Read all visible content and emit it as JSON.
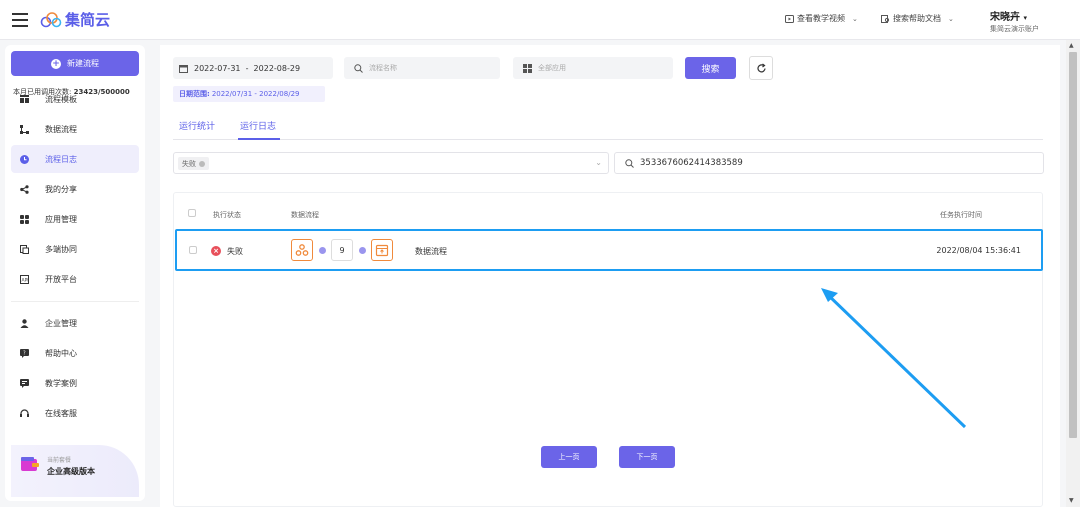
{
  "header": {
    "logo_text": "集简云",
    "link_video": "查看教学视频",
    "link_docs": "搜索帮助文档",
    "user_name": "宋晓卉",
    "user_account": "集简云演示账户"
  },
  "sidebar": {
    "new_button": "新建流程",
    "items": [
      {
        "label": "流程模板",
        "icon": "template-icon"
      },
      {
        "label": "数据流程",
        "icon": "flow-icon"
      },
      {
        "label": "流程日志",
        "icon": "log-icon",
        "active": true
      },
      {
        "label": "我的分享",
        "icon": "share-icon"
      },
      {
        "label": "应用管理",
        "icon": "apps-icon"
      },
      {
        "label": "多端协同",
        "icon": "sync-icon"
      },
      {
        "label": "开放平台",
        "icon": "api-icon"
      },
      {
        "label": "企业管理",
        "icon": "enterprise-icon"
      },
      {
        "label": "帮助中心",
        "icon": "help-icon"
      },
      {
        "label": "教学案例",
        "icon": "case-icon"
      },
      {
        "label": "在线客服",
        "icon": "headset-icon"
      }
    ],
    "plan_label": "当前套餐",
    "plan_name": "企业高级版本",
    "usage_label": "本月已用调用次数:",
    "usage_value": "23423/500000"
  },
  "filters": {
    "date_range": "2022-07-31  -  2022-08-29",
    "date_hint_label": "日期范围:",
    "date_hint_value": "2022/07/31 - 2022/08/29",
    "flow_name_placeholder": "流程名称",
    "app_placeholder": "全部应用",
    "search_button": "搜索",
    "status_tag": "失败",
    "id_search_value": "3533676062414383589"
  },
  "tabs": [
    "运行统计",
    "运行日志"
  ],
  "table": {
    "headers": {
      "status": "执行状态",
      "flow": "数据流程",
      "time": "任务执行时间"
    },
    "rows": [
      {
        "status": "失败",
        "flow_step_count": "9",
        "flow_name": "数据流程",
        "time": "2022/08/04 15:36:41"
      }
    ]
  },
  "pagination": {
    "prev": "上一页",
    "next": "下一页"
  },
  "colors": {
    "accent": "#6b64e8",
    "highlight": "#1d9df2",
    "fail": "#e8505b",
    "flow_icon": "#f08a3c"
  }
}
